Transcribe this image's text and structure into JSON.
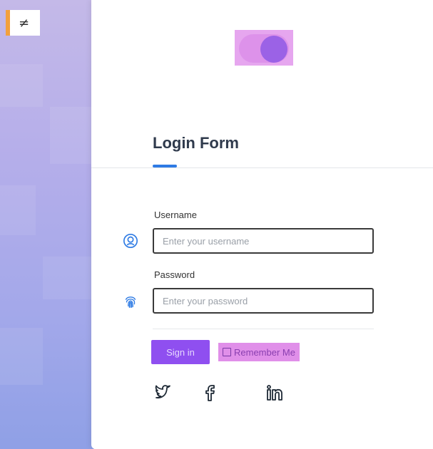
{
  "left_badge": {
    "symbol": "≠"
  },
  "form": {
    "title": "Login Form",
    "username": {
      "label": "Username",
      "placeholder": "Enter your username",
      "value": ""
    },
    "password": {
      "label": "Password",
      "placeholder": "Enter your password",
      "value": ""
    },
    "signin_label": "Sign in",
    "remember_label": "Remember Me"
  },
  "icons": {
    "user": "user-circle-icon",
    "fingerprint": "fingerprint-icon",
    "social": [
      "twitter-icon",
      "facebook-icon",
      "linkedin-icon"
    ]
  },
  "colors": {
    "accent_blue": "#2e7be4",
    "signin_purple": "#8f4ff0",
    "highlight_pink": "#e08fe9",
    "toggle_knob": "#9b62e6",
    "badge_orange": "#f2a03d"
  }
}
